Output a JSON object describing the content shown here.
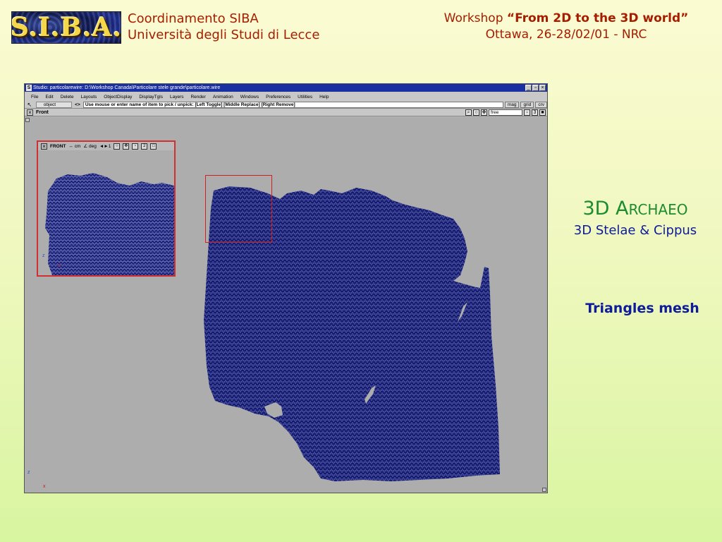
{
  "slide": {
    "logo_text": "S.I.B.A.",
    "org_line1": "Coordinamento SIBA",
    "org_line2": "Università degli Studi di Lecce",
    "workshop_prefix": "Workshop ",
    "workshop_title": "“From 2D to the 3D world”",
    "workshop_line2": "Ottawa, 26-28/02/01 - NRC",
    "side_title_a": "3D A",
    "side_title_b": "RCHAEO",
    "side_subtitle": "3D Stelae & Cippus",
    "side_note": "Triangles mesh"
  },
  "window": {
    "app_icon": "S",
    "title": "Studio: particolarewire: D:\\Workshop Canada\\Particolare stele grande\\particolare.wire",
    "title_buttons": [
      "_",
      "▫",
      "×"
    ],
    "menu": [
      "File",
      "Edit",
      "Delete",
      "Layouts",
      "ObjectDisplay",
      "DisplayTgls",
      "Layers",
      "Render",
      "Animation",
      "Windows",
      "Preferences",
      "Utilities",
      "Help"
    ],
    "mode_field": "object",
    "arrows": "<>",
    "prompt": "Use mouse or enter name of item to pick / unpick: [Left Toggle] [Middle Replace] [Right Remove]",
    "cmd_buttons": [
      "mag",
      "grid",
      "crv"
    ],
    "view_title": "Front",
    "view_field": "free",
    "view_num": "3"
  },
  "inset": {
    "label": "FRONT",
    "unit": "↔ cm",
    "angle": "∠ deg",
    "step": "◄►1",
    "num": "2"
  },
  "axes": {
    "z": "z",
    "x": "x"
  },
  "colors": {
    "mesh": "#161a6e",
    "mesh_line": "#7a86c8",
    "selection": "#d02020",
    "titlebar": "#1a2fa0",
    "accent_red": "#a61d00",
    "accent_green": "#1c8c2e",
    "accent_blue": "#0e1b9a"
  }
}
